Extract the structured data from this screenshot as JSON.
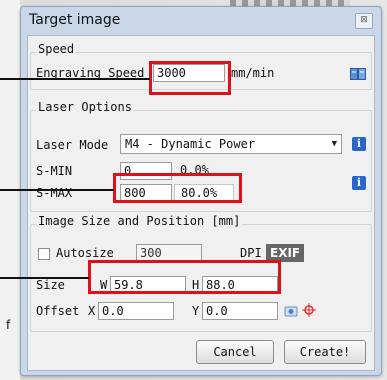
{
  "dialog": {
    "title": "Target image",
    "close_glyph": "⊠"
  },
  "speed": {
    "section": "Speed",
    "engraving_label": "Engraving Speed",
    "engraving_value": "3000",
    "unit": "mm/min"
  },
  "laser": {
    "section": "Laser Options",
    "mode_label": "Laser Mode",
    "mode_value": "M4 - Dynamic Power",
    "smin_label": "S-MIN",
    "smin_value": "0",
    "smin_percent": "0.0%",
    "smax_label": "S-MAX",
    "smax_value": "800",
    "smax_percent": "80.0%",
    "info_glyph": "i"
  },
  "image": {
    "section": "Image Size and Position [mm]",
    "autosize_label": "Autosize",
    "dpi_value": "300",
    "dpi_label": "DPI",
    "exif_label": "EXIF",
    "size_label": "Size",
    "w_label": "W",
    "w_value": "59.8",
    "h_label": "H",
    "h_value": "88.0",
    "offset_label": "Offset",
    "x_label": "X",
    "x_value": "0.0",
    "y_label": "Y",
    "y_value": "0.0"
  },
  "buttons": {
    "cancel": "Cancel",
    "create": "Create!"
  },
  "annotation": {
    "stray_text": "f"
  },
  "colors": {
    "highlight": "#e0101a",
    "info_icon": "#2c64c8"
  }
}
